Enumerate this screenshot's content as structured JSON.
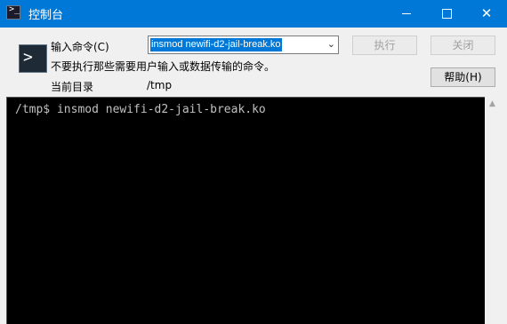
{
  "window": {
    "title": "控制台",
    "icon": "console-icon",
    "controls": {
      "minimize": "minimize-icon",
      "maximize": "maximize-icon",
      "close": "✕"
    }
  },
  "panel": {
    "command_label": "输入命令(C)",
    "command_value": "insmod newifi-d2-jail-break.ko",
    "hint": "不要执行那些需要用户输入或数据传输的命令。",
    "dir_label": "当前目录",
    "dir_value": "/tmp",
    "execute_label": "执行",
    "close_label": "关闭",
    "help_label": "帮助(H)"
  },
  "console": {
    "lines": [
      "/tmp$ insmod newifi-d2-jail-break.ko"
    ]
  },
  "colors": {
    "titlebar": "#0078d7",
    "console_bg": "#000000",
    "console_text": "#c0c0c0"
  }
}
